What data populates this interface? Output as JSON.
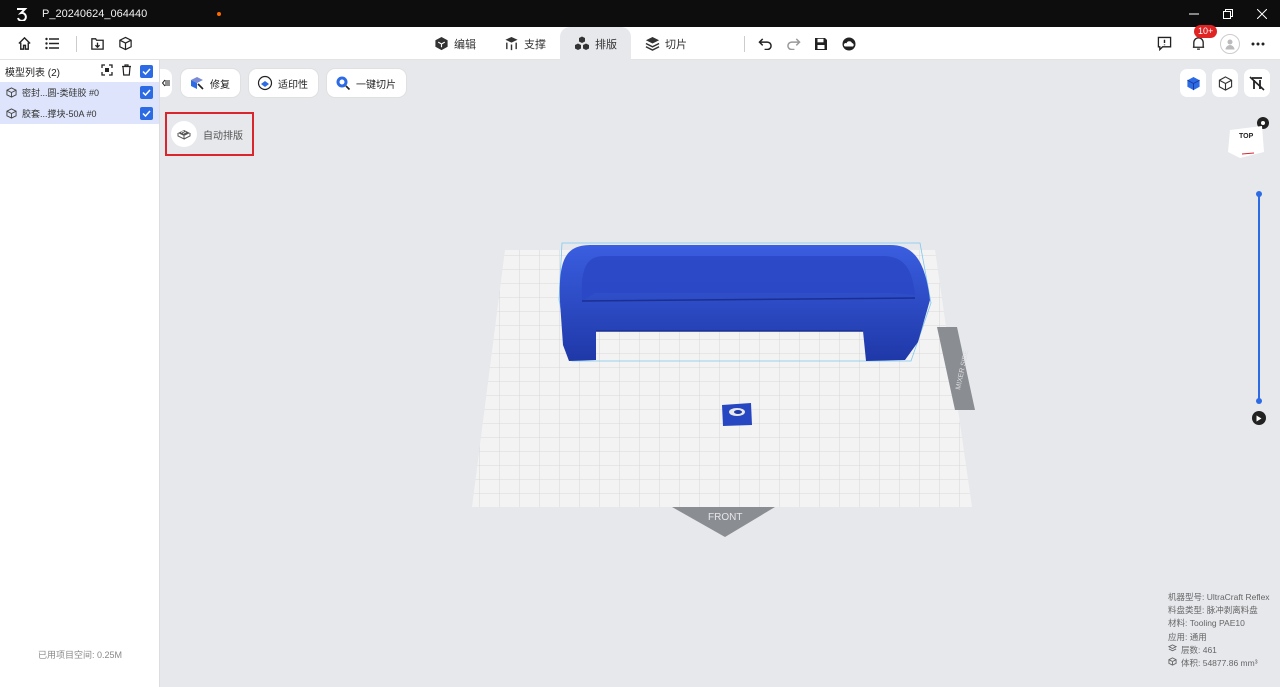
{
  "window": {
    "title": "P_20240624_064440"
  },
  "tabs": [
    {
      "label": "编辑",
      "icon": "edit-cube-icon"
    },
    {
      "label": "支撑",
      "icon": "support-icon"
    },
    {
      "label": "排版",
      "icon": "layout-icon"
    },
    {
      "label": "切片",
      "icon": "slice-icon"
    }
  ],
  "notifications": {
    "badge": "10+"
  },
  "sidebar": {
    "header": "模型列表 (2)",
    "items": [
      {
        "label": "密封...圆-类硅胶 #0"
      },
      {
        "label": "胶套...撑块-50A #0"
      }
    ],
    "footer": "已用项目空间: 0.25M"
  },
  "viewport": {
    "tools": [
      {
        "label": "修复"
      },
      {
        "label": "适印性"
      },
      {
        "label": "一键切片"
      }
    ],
    "auto_layout_label": "自动排版",
    "plate_front_label": "FRONT",
    "plate_side_label": "MIXER SIDE",
    "view_cube_label": "TOP",
    "colors": {
      "accent": "#2d6be4",
      "model": "#2747c2",
      "highlight": "#d8262c"
    }
  },
  "info": {
    "machine": "机器型号:  UltraCraft Reflex",
    "tray": "料盘类型:  脉冲剥离料盘",
    "material": "材料:  Tooling PAE10",
    "application": "应用:  通用",
    "layers": "层数: 461",
    "volume": "体积: 54877.86 mm³"
  }
}
